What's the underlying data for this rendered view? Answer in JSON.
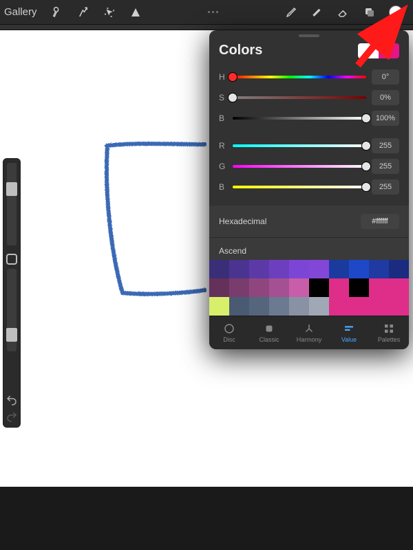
{
  "toolbar": {
    "gallery": "Gallery"
  },
  "panel": {
    "title": "Colors",
    "hsb": {
      "h_label": "H",
      "s_label": "S",
      "b_label": "B",
      "h_val": "0°",
      "s_val": "0%",
      "b_val": "100%"
    },
    "rgb": {
      "r_label": "R",
      "g_label": "G",
      "b_label": "B",
      "r_val": "255",
      "g_val": "255",
      "b_val": "255"
    },
    "hex_label": "Hexadecimal",
    "hex_val": "#ffffff",
    "ascend_label": "Ascend",
    "tabs": {
      "disc": "Disc",
      "classic": "Classic",
      "harmony": "Harmony",
      "value": "Value",
      "palettes": "Palettes"
    },
    "palette_colors": [
      "#3a2e78",
      "#4a3490",
      "#5b3aa8",
      "#6c3fbf",
      "#7d45d6",
      "#8347d8",
      "#1a3a9e",
      "#1e48c8",
      "#1f3aa0",
      "#1a2b80",
      "#64315a",
      "#7a3c6d",
      "#8f467f",
      "#a45092",
      "#c85da9",
      "#000000",
      "#de2e8a",
      "#000000",
      "#de2e8a",
      "#de2e8a",
      "#d7ef6a",
      "#4a5a72",
      "#55657c",
      "#6b7a90",
      "#8892a4",
      "#a0a7b5",
      "#de2e8a",
      "#de2e8a",
      "#de2e8a",
      "#de2e8a"
    ]
  }
}
